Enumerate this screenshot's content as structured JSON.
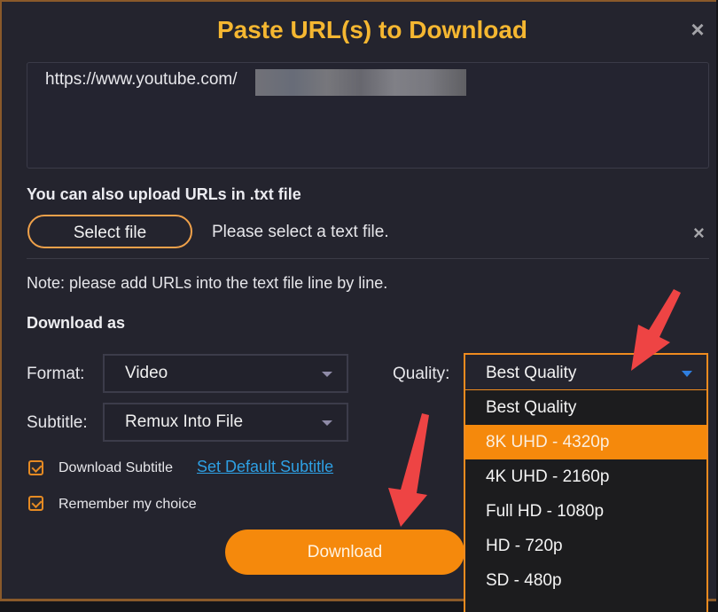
{
  "dialog": {
    "title": "Paste URL(s) to Download",
    "close_icon": "close-icon"
  },
  "url_input": {
    "value": "https://www.youtube.com/",
    "redacted": true
  },
  "upload": {
    "label": "You can also upload URLs in .txt file",
    "select_file_label": "Select file",
    "status": "Please select a text file.",
    "clear_icon": "close-icon",
    "note": "Note: please add URLs into the text file line by line."
  },
  "download_as": {
    "heading": "Download as",
    "format": {
      "label": "Format:",
      "value": "Video"
    },
    "subtitle": {
      "label": "Subtitle:",
      "value": "Remux Into File"
    },
    "quality": {
      "label": "Quality:",
      "value": "Best Quality",
      "options": [
        {
          "label": "Best Quality",
          "highlighted": false
        },
        {
          "label": "8K UHD - 4320p",
          "highlighted": true
        },
        {
          "label": "4K UHD - 2160p",
          "highlighted": false
        },
        {
          "label": "Full HD - 1080p",
          "highlighted": false
        },
        {
          "label": "HD - 720p",
          "highlighted": false
        },
        {
          "label": "SD - 480p",
          "highlighted": false
        }
      ]
    }
  },
  "options": {
    "download_subtitle": {
      "label": "Download Subtitle",
      "checked": true
    },
    "set_default_subtitle_link": "Set Default Subtitle",
    "remember_choice": {
      "label": "Remember my choice",
      "checked": true
    }
  },
  "download_button": "Download",
  "colors": {
    "accent_orange": "#f5890c",
    "title_yellow": "#f5b731",
    "link_blue": "#2ea0e4",
    "annotation_arrow_red": "#ee4444",
    "background": "#24242e"
  }
}
